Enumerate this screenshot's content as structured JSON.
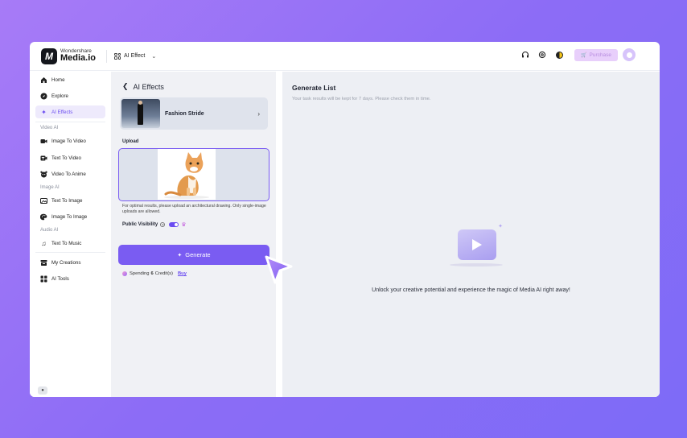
{
  "header": {
    "logo_brand": "Wondershare",
    "logo_name": "Media.io",
    "logo_mark": "M",
    "effect_menu_label": "AI Effect",
    "purchase_label": "Purchase",
    "icons": [
      "headset-icon",
      "settings-icon",
      "theme-toggle-icon",
      "cart-icon",
      "avatar-icon"
    ]
  },
  "sidebar": {
    "home": "Home",
    "explore": "Explore",
    "ai_effects": "AI Effects",
    "section_video": "Video AI",
    "image_to_video": "Image To Video",
    "text_to_video": "Text To Video",
    "video_to_anime": "Video To Anime",
    "section_image": "Image AI",
    "text_to_image": "Text To Image",
    "image_to_image": "Image To Image",
    "section_audio": "Audio AI",
    "text_to_music": "Text To Music",
    "my_creations": "My Creations",
    "ai_tools": "AI Tools"
  },
  "panel": {
    "title": "AI Effects",
    "effect_name": "Fashion Stride",
    "upload_label": "Upload",
    "hint": "For optimal results, please upload an architectural drawing. Only single-image uploads are allowed.",
    "visibility_label": "Public Visibility",
    "visibility_on": true,
    "generate_label": "Generate",
    "spending_prefix": "Spending",
    "spending_amount": "6",
    "spending_suffix": "Credit(s)",
    "buy_label": "Buy"
  },
  "results": {
    "title": "Generate List",
    "subtitle": "Your task results will be kept for 7 days. Please check them in time.",
    "empty_message": "Unlock your creative potential and experience the magic of Media AI right away!"
  },
  "colors": {
    "accent": "#7a5cf2",
    "active_bg": "#eeeafc",
    "background_gradient": [
      "#a77bf7",
      "#7d6bf7"
    ]
  }
}
